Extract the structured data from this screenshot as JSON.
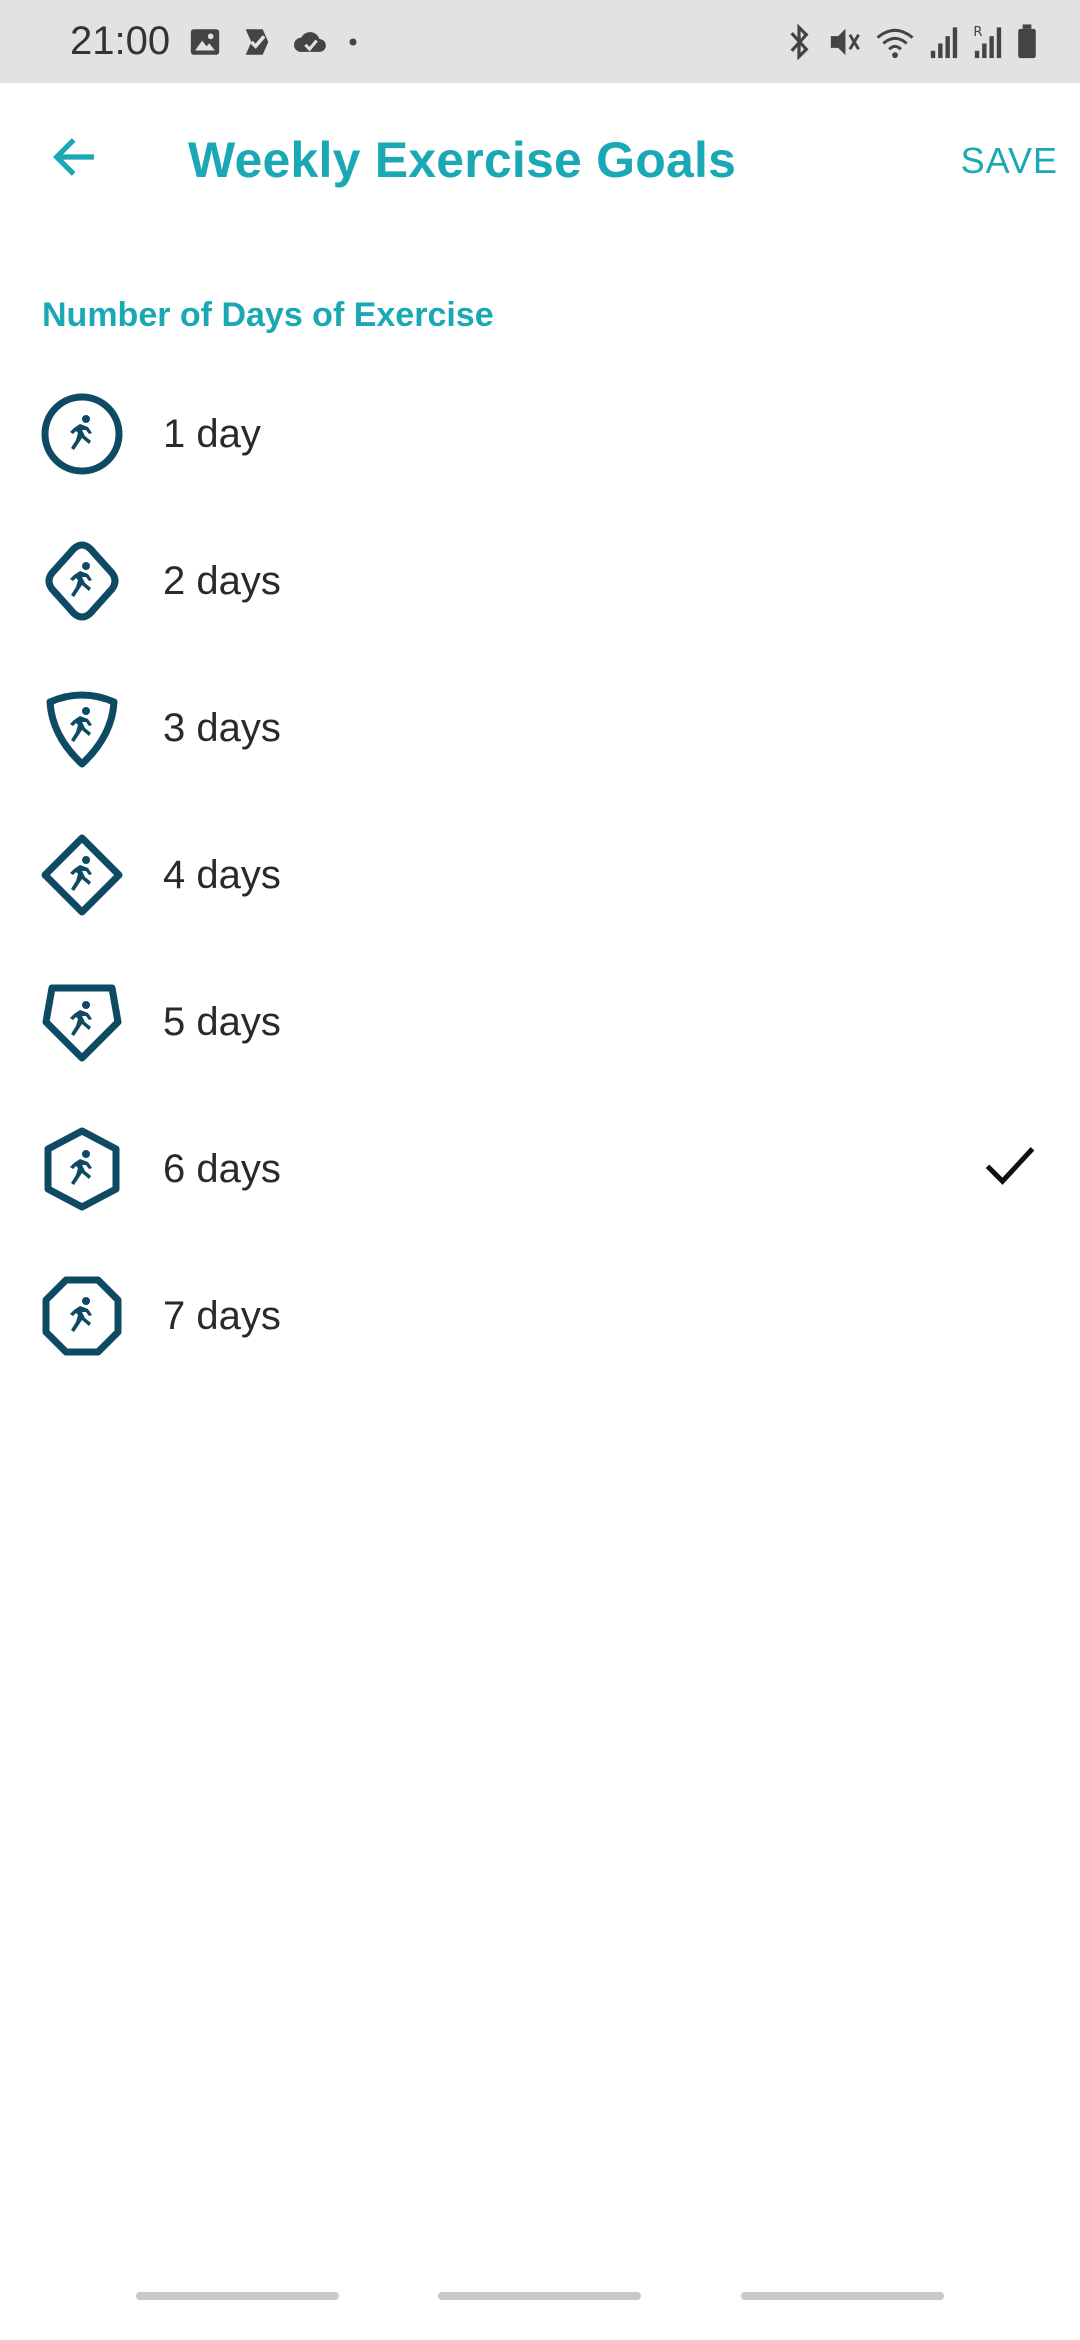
{
  "status_bar": {
    "time": "21:00",
    "left_icons": [
      "image-icon",
      "task-check-icon",
      "cloud-check-icon",
      "dot-icon"
    ],
    "right_icons": [
      "bluetooth-icon",
      "mute-icon",
      "wifi-icon",
      "signal-icon",
      "signal-roaming-icon",
      "battery-icon"
    ]
  },
  "app_bar": {
    "title": "Weekly Exercise Goals",
    "save_label": "SAVE",
    "back_icon": "arrow-left-icon"
  },
  "section": {
    "header": "Number of Days of Exercise"
  },
  "options": [
    {
      "label": "1 day",
      "badge": "circle",
      "selected": false
    },
    {
      "label": "2 days",
      "badge": "rounded-diamond",
      "selected": false
    },
    {
      "label": "3 days",
      "badge": "shield",
      "selected": false
    },
    {
      "label": "4 days",
      "badge": "diamond",
      "selected": false
    },
    {
      "label": "5 days",
      "badge": "pentagon",
      "selected": false
    },
    {
      "label": "6 days",
      "badge": "hexagon",
      "selected": true
    },
    {
      "label": "7 days",
      "badge": "octagon",
      "selected": false
    }
  ],
  "colors": {
    "accent": "#1ba8b5",
    "badge": "#0e4a63",
    "text": "#2a2a2a",
    "status_bar_bg": "#e2e2e2"
  }
}
